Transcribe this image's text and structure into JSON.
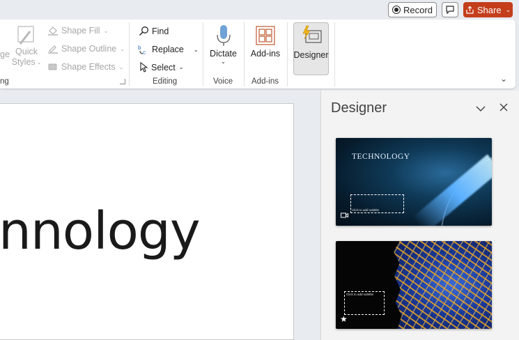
{
  "topbar": {
    "record_label": "Record",
    "share_label": "Share",
    "share_color": "#c43e1c"
  },
  "ribbon": {
    "drawing": {
      "partial_label_1": "ge",
      "quick_styles_line1": "Quick",
      "quick_styles_line2": "Styles",
      "shape_fill": "Shape Fill",
      "shape_outline": "Shape Outline",
      "shape_effects": "Shape Effects",
      "group_label_partial": "ng"
    },
    "editing": {
      "find": "Find",
      "replace": "Replace",
      "select": "Select",
      "group_label": "Editing"
    },
    "voice": {
      "dictate": "Dictate",
      "group_label": "Voice"
    },
    "addins": {
      "addins": "Add-ins",
      "group_label": "Add-ins"
    },
    "designer": {
      "label": "Designer"
    }
  },
  "slide": {
    "visible_text": "nnology"
  },
  "designer_pane": {
    "title": "Designer",
    "thumbnails": [
      {
        "title": "TECHNOLOGY",
        "subtitle_placeholder": "Click to add subtitle"
      },
      {
        "subtitle_placeholder": "Click to add subtitle"
      }
    ]
  }
}
